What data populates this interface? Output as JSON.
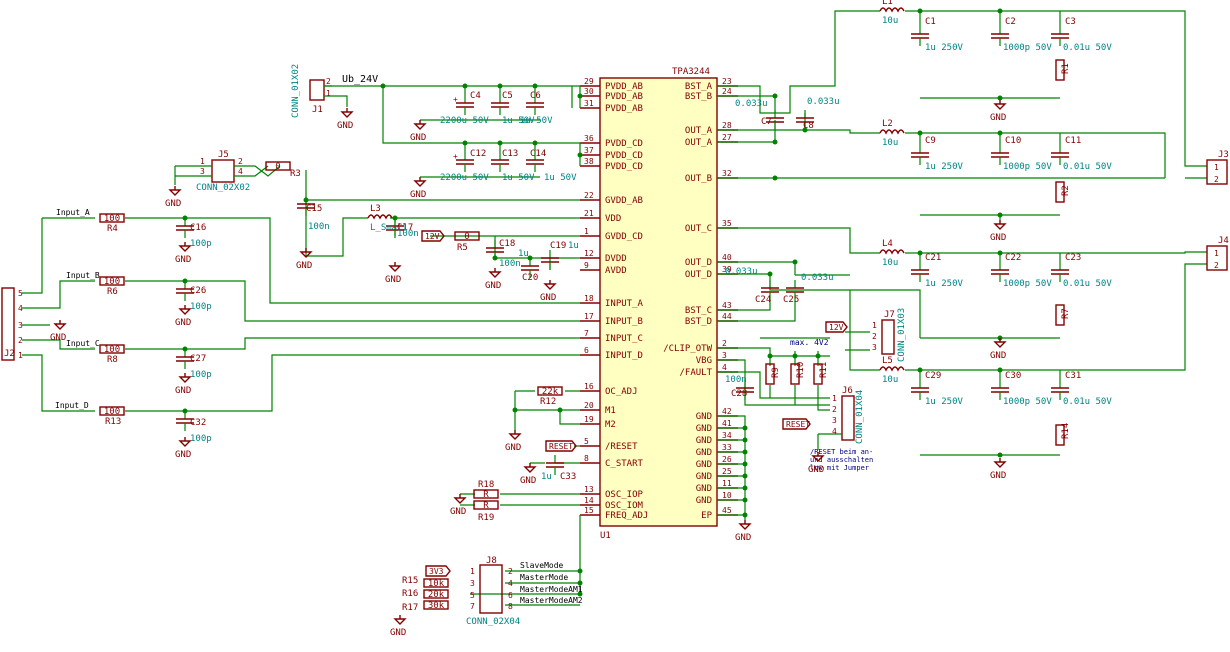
{
  "ic": {
    "name": "TPA3244",
    "ref": "U1",
    "left_pins": [
      {
        "num": "29",
        "name": "PVDD_AB"
      },
      {
        "num": "30",
        "name": "PVDD_AB"
      },
      {
        "num": "31",
        "name": "PVDD_AB"
      },
      {
        "num": "36",
        "name": "PVDD_CD"
      },
      {
        "num": "37",
        "name": "PVDD_CD"
      },
      {
        "num": "38",
        "name": "PVDD_CD"
      },
      {
        "num": "22",
        "name": "GVDD_AB"
      },
      {
        "num": "21",
        "name": "VDD"
      },
      {
        "num": "1",
        "name": "GVDD_CD"
      },
      {
        "num": "12",
        "name": "DVDD"
      },
      {
        "num": "9",
        "name": "AVDD"
      },
      {
        "num": "18",
        "name": "INPUT_A"
      },
      {
        "num": "17",
        "name": "INPUT_B"
      },
      {
        "num": "7",
        "name": "INPUT_C"
      },
      {
        "num": "6",
        "name": "INPUT_D"
      },
      {
        "num": "16",
        "name": "OC_ADJ"
      },
      {
        "num": "20",
        "name": "M1"
      },
      {
        "num": "19",
        "name": "M2"
      },
      {
        "num": "5",
        "name": "/RESET"
      },
      {
        "num": "8",
        "name": "C_START"
      },
      {
        "num": "13",
        "name": "OSC_IOP"
      },
      {
        "num": "14",
        "name": "OSC_IOM"
      },
      {
        "num": "15",
        "name": "FREQ_ADJ"
      }
    ],
    "right_pins": [
      {
        "num": "23",
        "name": "BST_A"
      },
      {
        "num": "24",
        "name": "BST_B"
      },
      {
        "num": "28",
        "name": "OUT_A"
      },
      {
        "num": "27",
        "name": "OUT_A"
      },
      {
        "num": "32",
        "name": "OUT_B"
      },
      {
        "num": "35",
        "name": "OUT_C"
      },
      {
        "num": "40",
        "name": "OUT_D"
      },
      {
        "num": "39",
        "name": "OUT_D"
      },
      {
        "num": "43",
        "name": "BST_C"
      },
      {
        "num": "44",
        "name": "BST_D"
      },
      {
        "num": "2",
        "name": "/CLIP_OTW"
      },
      {
        "num": "3",
        "name": "VBG"
      },
      {
        "num": "4",
        "name": "/FAULT"
      },
      {
        "num": "42",
        "name": "GND"
      },
      {
        "num": "41",
        "name": "GND"
      },
      {
        "num": "34",
        "name": "GND"
      },
      {
        "num": "33",
        "name": "GND"
      },
      {
        "num": "26",
        "name": "GND"
      },
      {
        "num": "25",
        "name": "GND"
      },
      {
        "num": "11",
        "name": "GND"
      },
      {
        "num": "10",
        "name": "GND"
      },
      {
        "num": "45",
        "name": "EP"
      }
    ]
  },
  "labels": {
    "ub24": "Ub_24V",
    "gnd": "GND",
    "v12a": "12V",
    "v12b": "12V",
    "reset": "RESET",
    "reset2": "RESET",
    "v3v3": "3V3",
    "input_a": "Input_A",
    "input_b": "Input_B",
    "input_c": "Input_C",
    "input_d": "Input_D",
    "slave": "SlaveMode",
    "master": "MasterMode",
    "mam1": "MasterModeAM1",
    "mam2": "MasterModeAM2",
    "maxv": "max. 4V2",
    "note": [
      "/RESET beim an-",
      "und ausschalten",
      "low mit Jumper"
    ]
  },
  "connectors": {
    "j1": {
      "ref": "J1",
      "value": "CONN_01X02"
    },
    "j2": {
      "ref": "J2"
    },
    "j3": {
      "ref": "J3"
    },
    "j4": {
      "ref": "J4"
    },
    "j5": {
      "ref": "J5",
      "value": "CONN_02X02"
    },
    "j6": {
      "ref": "J6",
      "value": "CONN_01X04"
    },
    "j7": {
      "ref": "J7",
      "value": "CONN_01X03"
    },
    "j8": {
      "ref": "J8",
      "value": "CONN_02X04"
    }
  },
  "parts": {
    "c1": {
      "ref": "C1",
      "value": "1u 250V"
    },
    "c2": {
      "ref": "C2",
      "value": "1000p 50V"
    },
    "c3": {
      "ref": "C3",
      "value": "0.01u 50V"
    },
    "c9": {
      "ref": "C9",
      "value": "1u 250V"
    },
    "c10": {
      "ref": "C10",
      "value": "1000p 50V"
    },
    "c11": {
      "ref": "C11",
      "value": "0.01u 50V"
    },
    "c21": {
      "ref": "C21",
      "value": "1u 250V"
    },
    "c22": {
      "ref": "C22",
      "value": "1000p 50V"
    },
    "c23": {
      "ref": "C23",
      "value": "0.01u 50V"
    },
    "c29": {
      "ref": "C29",
      "value": "1u 250V"
    },
    "c30": {
      "ref": "C30",
      "value": "1000p 50V"
    },
    "c31": {
      "ref": "C31",
      "value": "0.01u 50V"
    },
    "c4": {
      "ref": "C4",
      "value": "2200u 50V"
    },
    "c5": {
      "ref": "C5",
      "value": "1u 50V"
    },
    "c6": {
      "ref": "C6",
      "value": "1u 50V"
    },
    "c12": {
      "ref": "C12",
      "value": "2200u 50V"
    },
    "c13": {
      "ref": "C13",
      "value": "1u 50V"
    },
    "c14": {
      "ref": "C14",
      "value": "1u 50V"
    },
    "c7": {
      "ref": "C7",
      "value": "0.033u"
    },
    "c8": {
      "ref": "C8",
      "value": "0.033u"
    },
    "c24": {
      "ref": "C24",
      "value": "0.033u"
    },
    "c25": {
      "ref": "C25",
      "value": "0.033u"
    },
    "c15": {
      "ref": "C15",
      "value": "100n"
    },
    "c17": {
      "ref": "C17",
      "value": "100n"
    },
    "c18": {
      "ref": "C18",
      "value": "100n"
    },
    "c19": {
      "ref": "C19",
      "value": "1u"
    },
    "c20": {
      "ref": "C20",
      "value": "1u"
    },
    "c16": {
      "ref": "C16",
      "value": "100p"
    },
    "c26": {
      "ref": "C26",
      "value": "100p"
    },
    "c27": {
      "ref": "C27",
      "value": "100p"
    },
    "c32": {
      "ref": "C32",
      "value": "100p"
    },
    "c28": {
      "ref": "C28",
      "value": "100n"
    },
    "c33": {
      "ref": "C33",
      "value": "1u"
    },
    "l1": {
      "ref": "L1",
      "value": "10u"
    },
    "l2": {
      "ref": "L2",
      "value": "10u"
    },
    "l4": {
      "ref": "L4",
      "value": "10u"
    },
    "l5": {
      "ref": "L5",
      "value": "10u"
    },
    "l3": {
      "ref": "L3",
      "value": "L_Small"
    },
    "r1": {
      "ref": "R1"
    },
    "r2": {
      "ref": "R2"
    },
    "r7": {
      "ref": "R7"
    },
    "r14": {
      "ref": "R14"
    },
    "r3": {
      "ref": "R3",
      "value": "0"
    },
    "r5": {
      "ref": "R5",
      "value": "0"
    },
    "r4": {
      "ref": "R4",
      "value": "100"
    },
    "r6": {
      "ref": "R6",
      "value": "100"
    },
    "r8": {
      "ref": "R8",
      "value": "100"
    },
    "r13": {
      "ref": "R13",
      "value": "100"
    },
    "r12": {
      "ref": "R12",
      "value": "22k"
    },
    "r18": {
      "ref": "R18",
      "value": "R"
    },
    "r19": {
      "ref": "R19",
      "value": "R"
    },
    "r9": {
      "ref": "R9",
      "value": "R"
    },
    "r10": {
      "ref": "R10",
      "value": "R"
    },
    "r11": {
      "ref": "R11",
      "value": "R"
    },
    "r15": {
      "ref": "R15",
      "value": "10k"
    },
    "r16": {
      "ref": "R16",
      "value": "20k"
    },
    "r17": {
      "ref": "R17",
      "value": "30k"
    }
  }
}
